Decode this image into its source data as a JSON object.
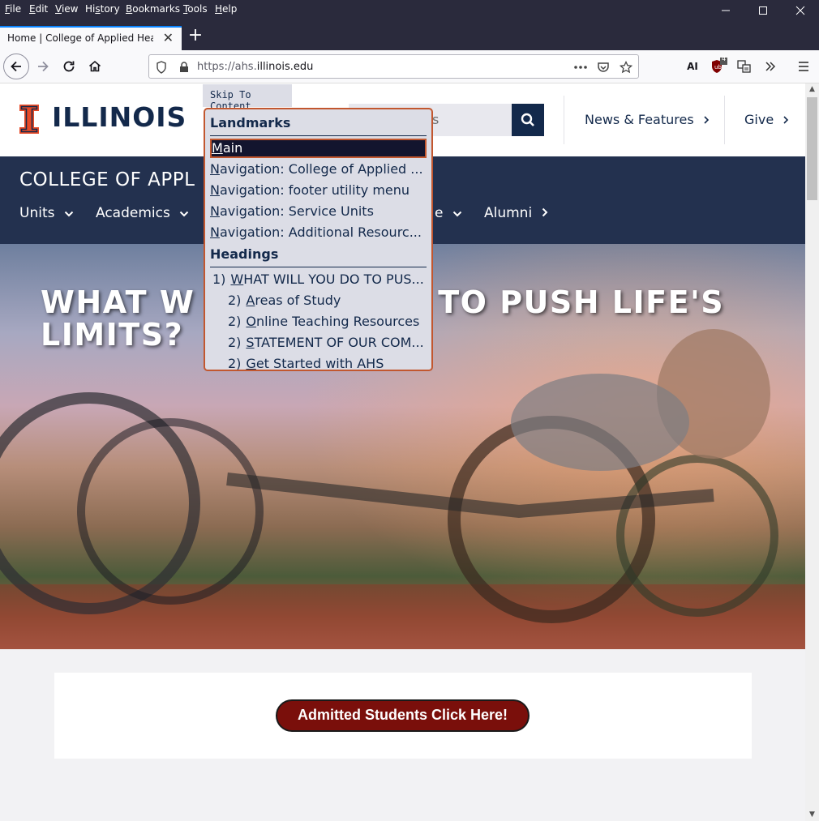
{
  "menubar": {
    "items": [
      {
        "key": "F",
        "rest": "ile"
      },
      {
        "key": "E",
        "rest": "dit"
      },
      {
        "key": "V",
        "rest": "iew"
      },
      {
        "key": "",
        "rest": "History",
        "pre": "Hi",
        "k2": "s",
        "post": "tory"
      },
      {
        "key": "B",
        "rest": "ookmarks"
      },
      {
        "key": "T",
        "rest": "ools"
      },
      {
        "key": "H",
        "rest": "elp"
      }
    ],
    "labels": [
      "File",
      "Edit",
      "View",
      "History",
      "Bookmarks",
      "Tools",
      "Help"
    ]
  },
  "tab": {
    "title": "Home | College of Applied Health S",
    "close": "✕"
  },
  "newtab": "+",
  "url": {
    "prefix": "https://ahs.",
    "domain": "illinois.edu"
  },
  "extensions": {
    "ai_label": "AI",
    "ublock_count": "4"
  },
  "header": {
    "logo": "ILLINOIS",
    "search_placeholder": "s",
    "links": [
      "News & Features",
      "Give"
    ]
  },
  "college": {
    "title": "COLLEGE OF APPL",
    "nav": [
      "Units",
      "Academics",
      "e",
      "Alumni"
    ]
  },
  "hero": {
    "title_line1": "WHAT W",
    "title_line1b": "TO PUSH LIFE'S",
    "title_line2": "LIMITS?"
  },
  "cta": {
    "label": "Admitted Students Click Here!"
  },
  "skipto": {
    "button": "Skip To Content",
    "landmarks_heading": "Landmarks",
    "landmarks": [
      {
        "acc": "M",
        "rest": "ain"
      },
      {
        "acc": "N",
        "rest": "avigation: College of Applied ..."
      },
      {
        "acc": "N",
        "rest": "avigation: footer utility menu"
      },
      {
        "acc": "N",
        "rest": "avigation: Service Units"
      },
      {
        "acc": "N",
        "rest": "avigation: Additional Resourc..."
      }
    ],
    "headings_heading": "Headings",
    "headings": [
      {
        "level": "1)",
        "acc": "W",
        "rest": "HAT WILL YOU DO TO PUS..."
      },
      {
        "level": "2)",
        "acc": "A",
        "rest": "reas of Study"
      },
      {
        "level": "2)",
        "acc": "O",
        "rest": "nline Teaching Resources"
      },
      {
        "level": "2)",
        "acc": "S",
        "rest": "TATEMENT OF OUR COM..."
      },
      {
        "level": "2)",
        "acc": "G",
        "rest": "et Started with AHS"
      }
    ]
  },
  "colors": {
    "accent": "#c2572f",
    "navy": "#13294b",
    "chrome": "#2a2a3c",
    "cta": "#7a0f0b"
  }
}
